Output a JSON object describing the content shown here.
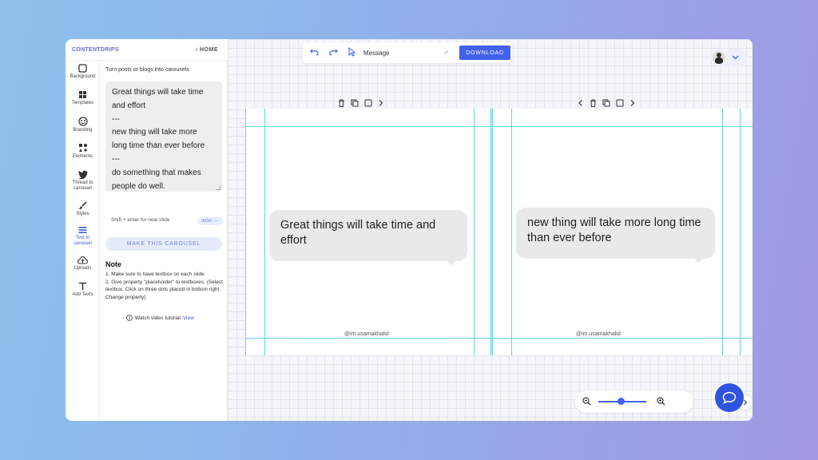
{
  "brand": {
    "name": "CONTENTDRIPS",
    "home_label": "‹ HOME"
  },
  "rail": [
    {
      "icon": "square-icon",
      "label": "Background"
    },
    {
      "icon": "grid-icon",
      "label": "Templates"
    },
    {
      "icon": "palette-icon",
      "label": "Branding"
    },
    {
      "icon": "shapes-icon",
      "label": "Elements"
    },
    {
      "icon": "twitter-icon",
      "label": "Thread to carousel"
    },
    {
      "icon": "brush-icon",
      "label": "Styles"
    },
    {
      "icon": "list-icon",
      "label": "Text to carousel",
      "active": true
    },
    {
      "icon": "upload-icon",
      "label": "Uploads"
    },
    {
      "icon": "text-icon",
      "label": "Add Texts"
    }
  ],
  "panel": {
    "subtitle": "Turn posts or blogs into carousels",
    "text_lines": [
      "Great things will take time",
      "and effort",
      "---",
      "new thing will take more",
      "long time than ever before",
      "---",
      "do something that makes",
      "people do well."
    ],
    "hint": "Shift + enter for new slide",
    "add_label": "ADD ---",
    "make_button": "MAKE THIS CAROUSEL",
    "note_title": "Note",
    "note_lines": [
      "1. Make sure to have textbox on each slide",
      "2. Give property \"placeholder\" to textboxes. (Select textbox. Click on three dots placed in bottom right. Change property)"
    ],
    "tutorial_text": "Watch video tutorial",
    "tutorial_link": "View"
  },
  "toolbar": {
    "message_label": "Message",
    "check": "✓",
    "download_label": "DOWNLOAD"
  },
  "slides": [
    {
      "text": "Great things will take time and effort",
      "handle": "@im.usamakhalid"
    },
    {
      "text": "new thing will take more long time than ever before",
      "handle": "@im.usamakhalid"
    }
  ],
  "colors": {
    "accent": "#4361ee",
    "brand": "#6b66e6",
    "guide": "#5fd5e4",
    "fab": "#2e55e0"
  }
}
